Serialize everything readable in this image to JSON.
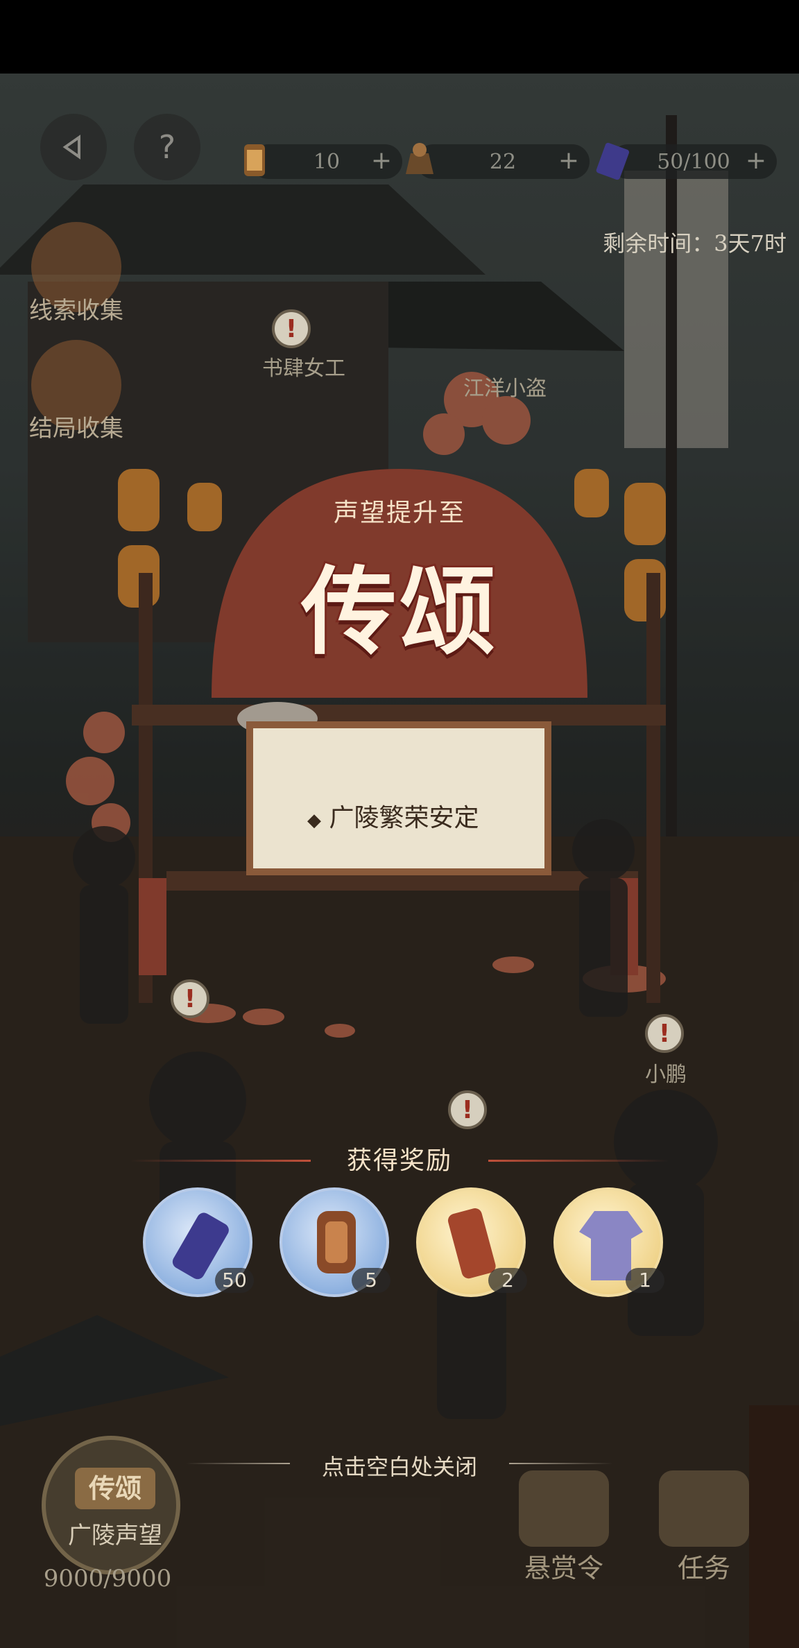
{
  "hud": {
    "resources": [
      {
        "icon": "scroll-token-icon",
        "value": "10",
        "plus": "+"
      },
      {
        "icon": "ink-stone-icon",
        "value": "22",
        "plus": "+"
      },
      {
        "icon": "book-energy-icon",
        "value": "50/100",
        "plus": "+"
      }
    ],
    "back_icon": "back-arrow-icon",
    "help_label": "?"
  },
  "event": {
    "time_remaining": "剩余时间：3天7时"
  },
  "side_menu": [
    {
      "label": "线索收集"
    },
    {
      "label": "结局收集"
    }
  ],
  "npc_labels": [
    {
      "text": "书肆女工"
    },
    {
      "text": "江洋小盗"
    },
    {
      "text": "小鹏"
    }
  ],
  "popup": {
    "reputation_title": "声望提升至",
    "reputation_level": "传颂",
    "board_text": "广陵繁荣安定",
    "rewards_title": "获得奖励",
    "rewards": [
      {
        "name": "energy-drink-can",
        "count": "50",
        "style": "blue"
      },
      {
        "name": "bounty-token",
        "count": "5",
        "style": "blue"
      },
      {
        "name": "guangling-pass",
        "count": "2",
        "style": "gold"
      },
      {
        "name": "purple-robe-outfit",
        "count": "1",
        "style": "gold"
      }
    ],
    "close_hint": "点击空白处关闭"
  },
  "bottom": {
    "reputation_badge": "传颂",
    "reputation_label": "广陵声望",
    "reputation_value": "9000/9000",
    "nav": [
      {
        "label": "悬赏令"
      },
      {
        "label": "任务"
      }
    ]
  }
}
